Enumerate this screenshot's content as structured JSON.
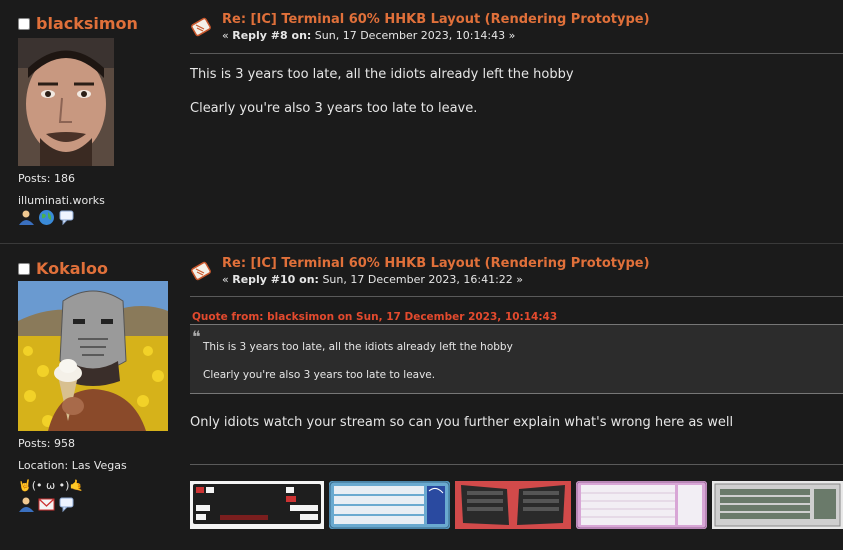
{
  "posts": [
    {
      "username": "blacksimon",
      "subject": "Re: [IC] Terminal 60% HHKB Layout (Rendering Prototype)",
      "reply_label": "Reply #8 on:",
      "reply_date": "Sun, 17 December 2023, 10:14:43 »",
      "reply_prefix": "«",
      "body": [
        "This is 3 years too late, all the idiots already left the hobby",
        "Clearly you're also 3 years too late to leave."
      ],
      "posts_count": "Posts: 186",
      "website": "illuminati.works",
      "icons": [
        "profile-icon",
        "globe-icon",
        "speech-bubble-icon"
      ]
    },
    {
      "username": "Kokaloo",
      "subject": "Re: [IC] Terminal 60% HHKB Layout (Rendering Prototype)",
      "reply_label": "Reply #10 on:",
      "reply_date": "Sun, 17 December 2023, 16:41:22 »",
      "reply_prefix": "«",
      "quote_header": "Quote from: blacksimon on Sun, 17 December 2023, 10:14:43",
      "quote_lines": [
        "This is 3 years too late, all the idiots already left the hobby",
        "Clearly you're also 3 years too late to leave."
      ],
      "body": "Only idiots watch your stream so can you further explain what's wrong here as well",
      "posts_count": "Posts: 958",
      "location": "Location: Las Vegas",
      "emoticon": "🤘(• ω •)🤙",
      "icons": [
        "profile-icon",
        "email-icon",
        "speech-bubble-icon"
      ],
      "signature_keyboards": [
        "keyboard-image-1",
        "keyboard-image-2",
        "keyboard-image-3",
        "keyboard-image-4",
        "keyboard-image-5"
      ]
    }
  ],
  "colors": {
    "background": "#1b1b1b",
    "username": "#e0703a",
    "subject": "#e0703a",
    "quote_header": "#e34a2e",
    "quote_bg": "#2c2c2c",
    "text": "#e6e6e6"
  }
}
